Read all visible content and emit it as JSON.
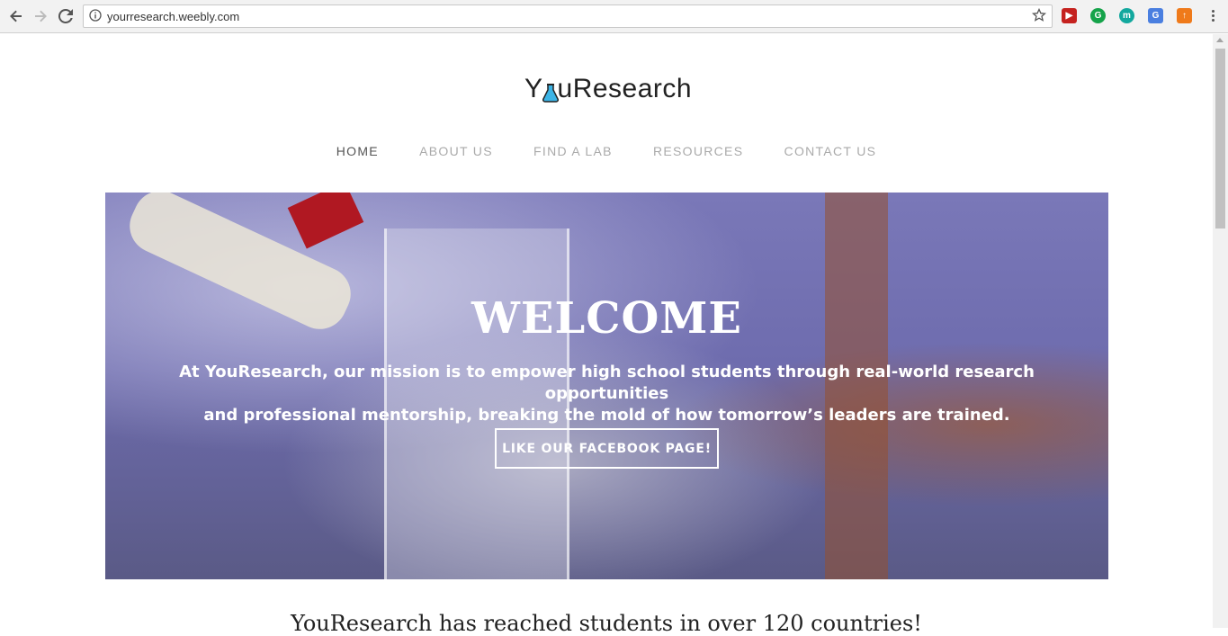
{
  "browser": {
    "url": "yourresearch.weebly.com",
    "extensions": [
      {
        "name": "video-ext-icon",
        "color": "#c5221f",
        "glyph": "▶"
      },
      {
        "name": "grammarly-icon",
        "color": "#15a34a",
        "glyph": "G"
      },
      {
        "name": "m-ext-icon",
        "color": "#13a89e",
        "glyph": "m"
      },
      {
        "name": "translate-icon",
        "color": "#4a7fe0",
        "glyph": "G"
      },
      {
        "name": "badge-ext-icon",
        "color": "#ef7a1a",
        "glyph": "↑"
      }
    ]
  },
  "site": {
    "logo_prefix": "Y",
    "logo_suffix": "uResearch",
    "nav": [
      {
        "label": "HOME",
        "active": true
      },
      {
        "label": "ABOUT US",
        "active": false
      },
      {
        "label": "FIND A LAB",
        "active": false
      },
      {
        "label": "RESOURCES",
        "active": false
      },
      {
        "label": "CONTACT US",
        "active": false
      }
    ]
  },
  "hero": {
    "title": "WELCOME",
    "text_line1": "At YouResearch, our mission is to empower high school students through real-world research opportunities",
    "text_line2": "and professional mentorship, breaking the mold of how tomorrow’s leaders are trained.",
    "button": "LIKE OUR FACEBOOK PAGE!"
  },
  "below_heading": "YouResearch has reached students in over 120 countries!"
}
